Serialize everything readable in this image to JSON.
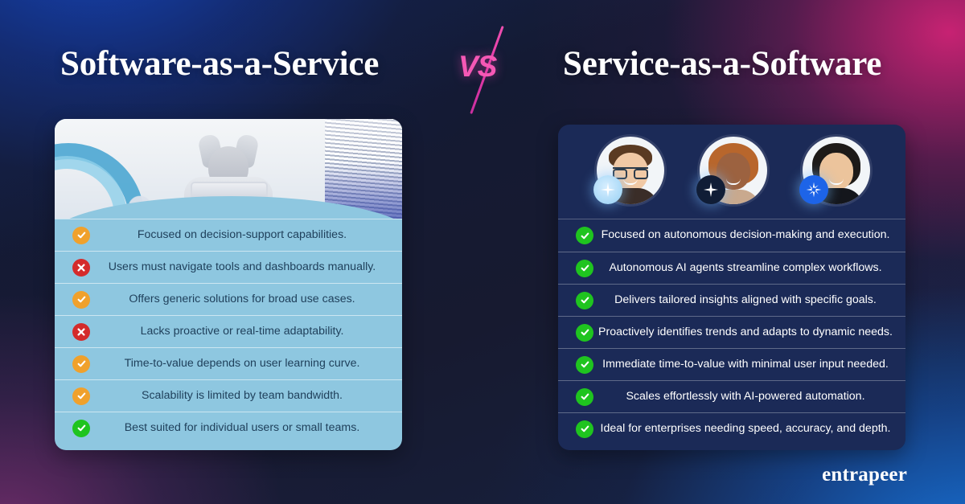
{
  "header": {
    "left_title": "Software-as-a-Service",
    "right_title": "Service-as-a-Software",
    "vs_label": "VS"
  },
  "left_card": {
    "media_alt": "stressed-person-at-laptop-with-paper-stacks",
    "items": [
      {
        "icon": "check-orange",
        "text": "Focused on decision-support capabilities."
      },
      {
        "icon": "cross-red",
        "text": "Users must navigate tools and dashboards manually."
      },
      {
        "icon": "check-orange",
        "text": "Offers generic solutions for broad use cases."
      },
      {
        "icon": "cross-red",
        "text": "Lacks proactive or real-time adaptability."
      },
      {
        "icon": "check-orange",
        "text": "Time-to-value depends on user learning curve."
      },
      {
        "icon": "check-orange",
        "text": "Scalability is limited by team bandwidth."
      },
      {
        "icon": "check-green",
        "text": "Best suited for individual users or small teams."
      }
    ]
  },
  "right_card": {
    "avatars": [
      {
        "name": "avatar-man-with-glasses",
        "badge": "ai-sparkle-badge-light"
      },
      {
        "name": "avatar-smiling-woman",
        "badge": "ai-sparkle-badge-dark"
      },
      {
        "name": "avatar-woman-dark-hair",
        "badge": "ai-sparkle-badge-blue"
      }
    ],
    "items": [
      {
        "icon": "check-green",
        "text": "Focused on autonomous decision-making and execution."
      },
      {
        "icon": "check-green",
        "text": "Autonomous AI agents streamline complex workflows."
      },
      {
        "icon": "check-green",
        "text": "Delivers tailored insights aligned with specific goals."
      },
      {
        "icon": "check-green",
        "text": "Proactively identifies trends and adapts to dynamic needs."
      },
      {
        "icon": "check-green",
        "text": "Immediate time-to-value with minimal user input needed."
      },
      {
        "icon": "check-green",
        "text": "Scales effortlessly with AI-powered automation."
      },
      {
        "icon": "check-green",
        "text": "Ideal for enterprises needing speed, accuracy, and depth."
      }
    ]
  },
  "footer": {
    "logo": "entrapeer"
  },
  "colors": {
    "accent_pink": "#f558b5",
    "left_card_bg": "#8ec7e0",
    "right_card_bg": "#1b2a57",
    "check_orange": "#f0a12c",
    "check_green": "#1fc41f",
    "cross_red": "#d42b2b",
    "left_text": "#20415c",
    "right_text": "#ffffff"
  }
}
